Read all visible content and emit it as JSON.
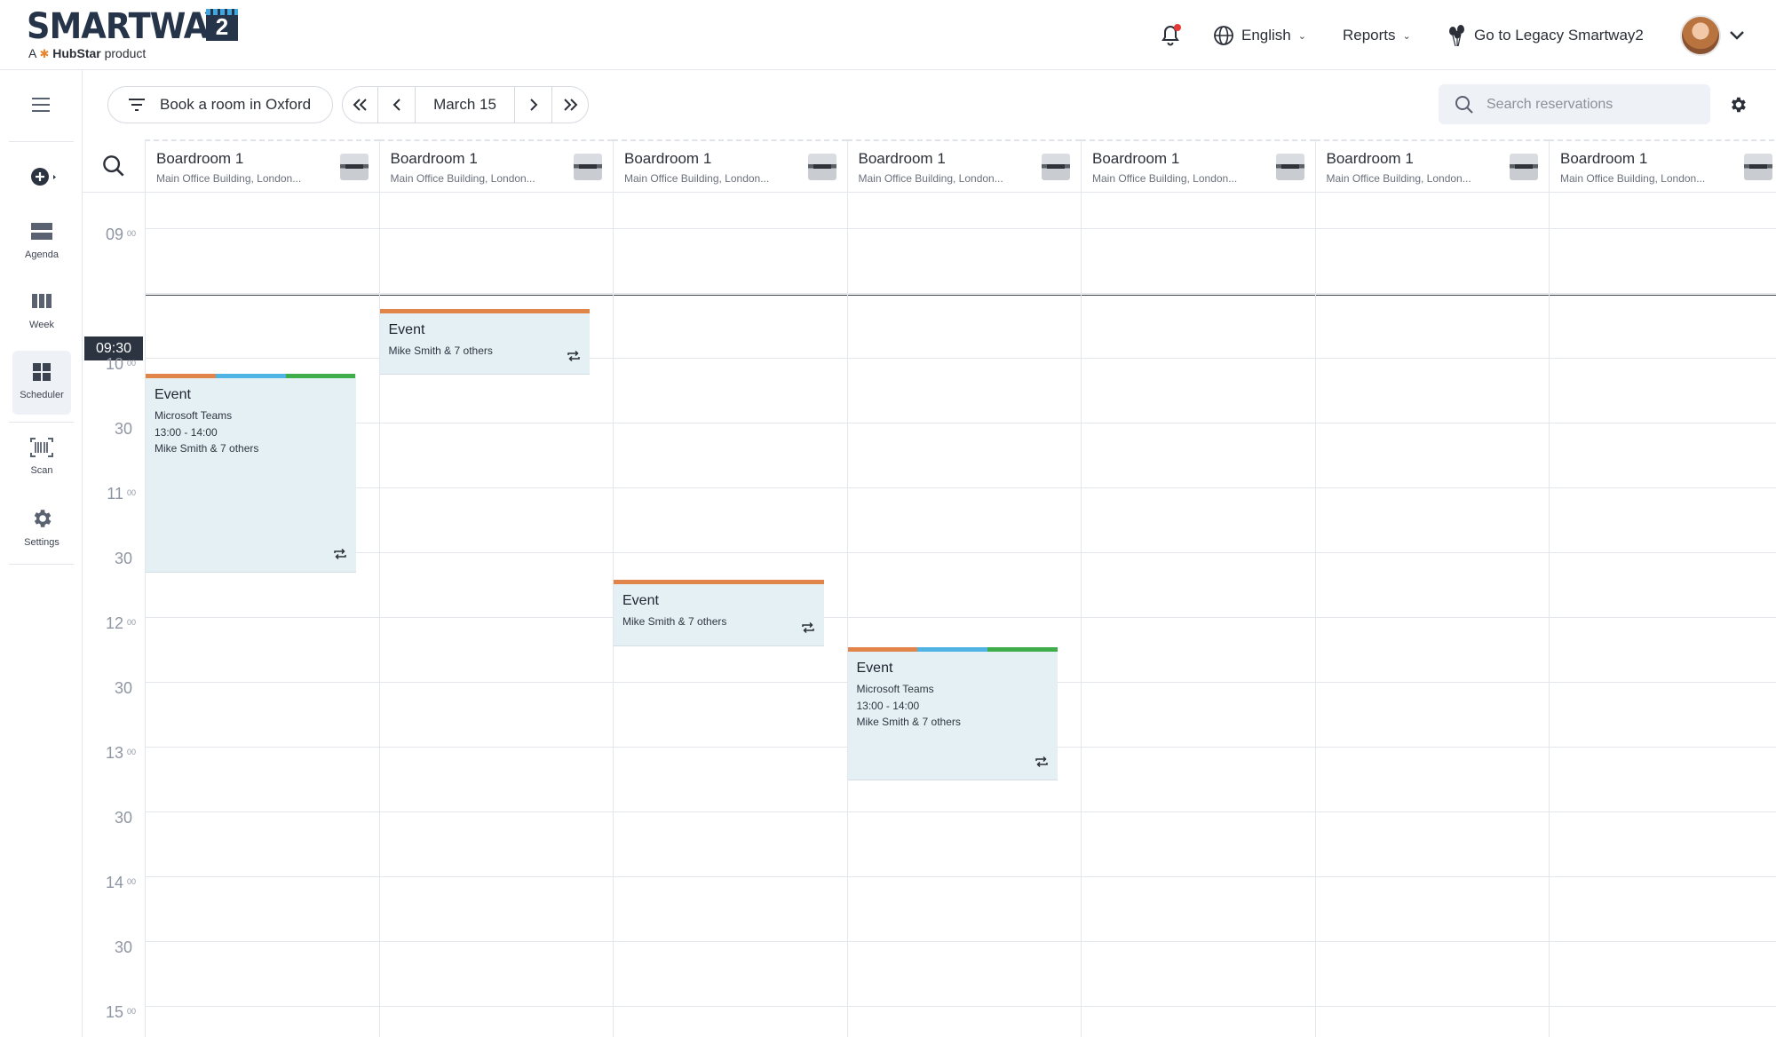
{
  "brand": {
    "logo_text": "SMARTWAY",
    "logo_badge": "2",
    "tagline_prefix": "A",
    "tagline_brand": "HubStar",
    "tagline_suffix": "product"
  },
  "header": {
    "language": "English",
    "reports": "Reports",
    "legacy_link": "Go to Legacy Smartway2"
  },
  "sidebar": {
    "items": [
      {
        "label": "Agenda",
        "icon": "agenda-icon"
      },
      {
        "label": "Week",
        "icon": "week-icon"
      },
      {
        "label": "Scheduler",
        "icon": "scheduler-icon",
        "active": true
      },
      {
        "label": "Scan",
        "icon": "barcode-icon"
      },
      {
        "label": "Settings",
        "icon": "gear-icon"
      }
    ]
  },
  "toolbar": {
    "book_label": "Book a room in Oxford",
    "date_label": "March 15",
    "search_placeholder": "Search reservations"
  },
  "scheduler": {
    "now_label": "09:30",
    "rooms": [
      {
        "name": "Boardroom 1",
        "location": "Main Office Building, London..."
      },
      {
        "name": "Boardroom 1",
        "location": "Main Office Building, London..."
      },
      {
        "name": "Boardroom 1",
        "location": "Main Office Building, London..."
      },
      {
        "name": "Boardroom 1",
        "location": "Main Office Building, London..."
      },
      {
        "name": "Boardroom 1",
        "location": "Main Office Building, London..."
      },
      {
        "name": "Boardroom 1",
        "location": "Main Office Building, London..."
      },
      {
        "name": "Boardroom 1",
        "location": "Main Office Building, London..."
      }
    ],
    "time_labels": [
      {
        "hour": "09",
        "min": "00"
      },
      {
        "hour": "10",
        "min": "00"
      },
      {
        "hour": "30",
        "min": ""
      },
      {
        "hour": "11",
        "min": "00"
      },
      {
        "hour": "30",
        "min": ""
      },
      {
        "hour": "12",
        "min": "00"
      },
      {
        "hour": "30",
        "min": ""
      },
      {
        "hour": "13",
        "min": "00"
      },
      {
        "hour": "30",
        "min": ""
      },
      {
        "hour": "14",
        "min": "00"
      },
      {
        "hour": "30",
        "min": ""
      },
      {
        "hour": "15",
        "min": "00"
      }
    ],
    "events": [
      {
        "title": "Event",
        "lines": [
          "Mike Smith & 7 others"
        ],
        "colors": [
          "#e0844a"
        ]
      },
      {
        "title": "Event",
        "lines": [
          "Microsoft Teams",
          "13:00 - 14:00",
          "Mike Smith & 7 others"
        ],
        "colors": [
          "#e0844a",
          "#4fb3e3",
          "#3fae4a"
        ]
      },
      {
        "title": "Event",
        "lines": [
          "Mike Smith & 7 others"
        ],
        "colors": [
          "#e0844a"
        ]
      },
      {
        "title": "Event",
        "lines": [
          "Microsoft Teams",
          "13:00 - 14:00",
          "Mike Smith & 7 others"
        ],
        "colors": [
          "#e0844a",
          "#4fb3e3",
          "#3fae4a"
        ]
      }
    ]
  }
}
